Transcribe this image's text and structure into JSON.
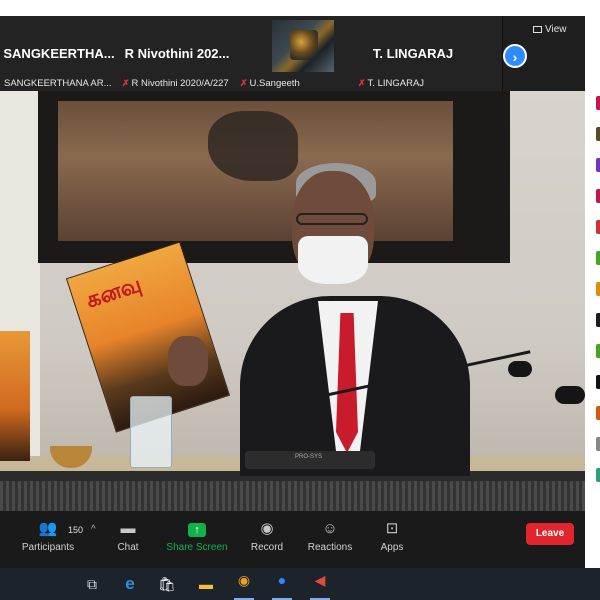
{
  "participants_strip": [
    {
      "display_name": "SANGKEERTHA...",
      "label": "SANGKEERTHANA AR...",
      "muted": false
    },
    {
      "display_name": "R Nivothini 202...",
      "label": "R Nivothini 2020/A/227",
      "muted": true
    },
    {
      "display_name": "",
      "label": "U.Sangeeth",
      "muted": true
    },
    {
      "display_name": "T. LINGARAJ",
      "label": "T. LINGARAJ",
      "muted": true
    }
  ],
  "next_page_icon": "chevron-right-icon",
  "view_button": {
    "label": "View"
  },
  "main_video": {
    "book_title": "கனவு",
    "mic_base_brand": "PRO-SYS"
  },
  "toolbar": {
    "participants": {
      "label": "Participants",
      "count": "150"
    },
    "chat": {
      "label": "Chat"
    },
    "share_screen": {
      "label": "Share Screen"
    },
    "record": {
      "label": "Record"
    },
    "reactions": {
      "label": "Reactions"
    },
    "apps": {
      "label": "Apps"
    },
    "leave": {
      "label": "Leave"
    }
  },
  "colors": {
    "leave": "#e0262c",
    "share": "#12b24a",
    "accent": "#2d8cff",
    "muted_mic": "#e0303a"
  },
  "side_avatar_colors": [
    "#c0184a",
    "#5a4a20",
    "#7b2fc8",
    "#c0184a",
    "#d03030",
    "#3ea820",
    "#e08a14",
    "#1d1d1d",
    "#3ea820",
    "#111",
    "#d05a14",
    "#888",
    "#2aa07a"
  ],
  "taskbar": [
    {
      "name": "task-view-icon",
      "glyph": "⧉"
    },
    {
      "name": "edge-icon",
      "glyph": "e"
    },
    {
      "name": "store-icon",
      "glyph": "🛍"
    },
    {
      "name": "file-explorer-icon",
      "glyph": "▬"
    },
    {
      "name": "chrome-icon",
      "glyph": "◉"
    },
    {
      "name": "zoom-icon",
      "glyph": "●"
    },
    {
      "name": "volume-icon",
      "glyph": "◀"
    }
  ]
}
